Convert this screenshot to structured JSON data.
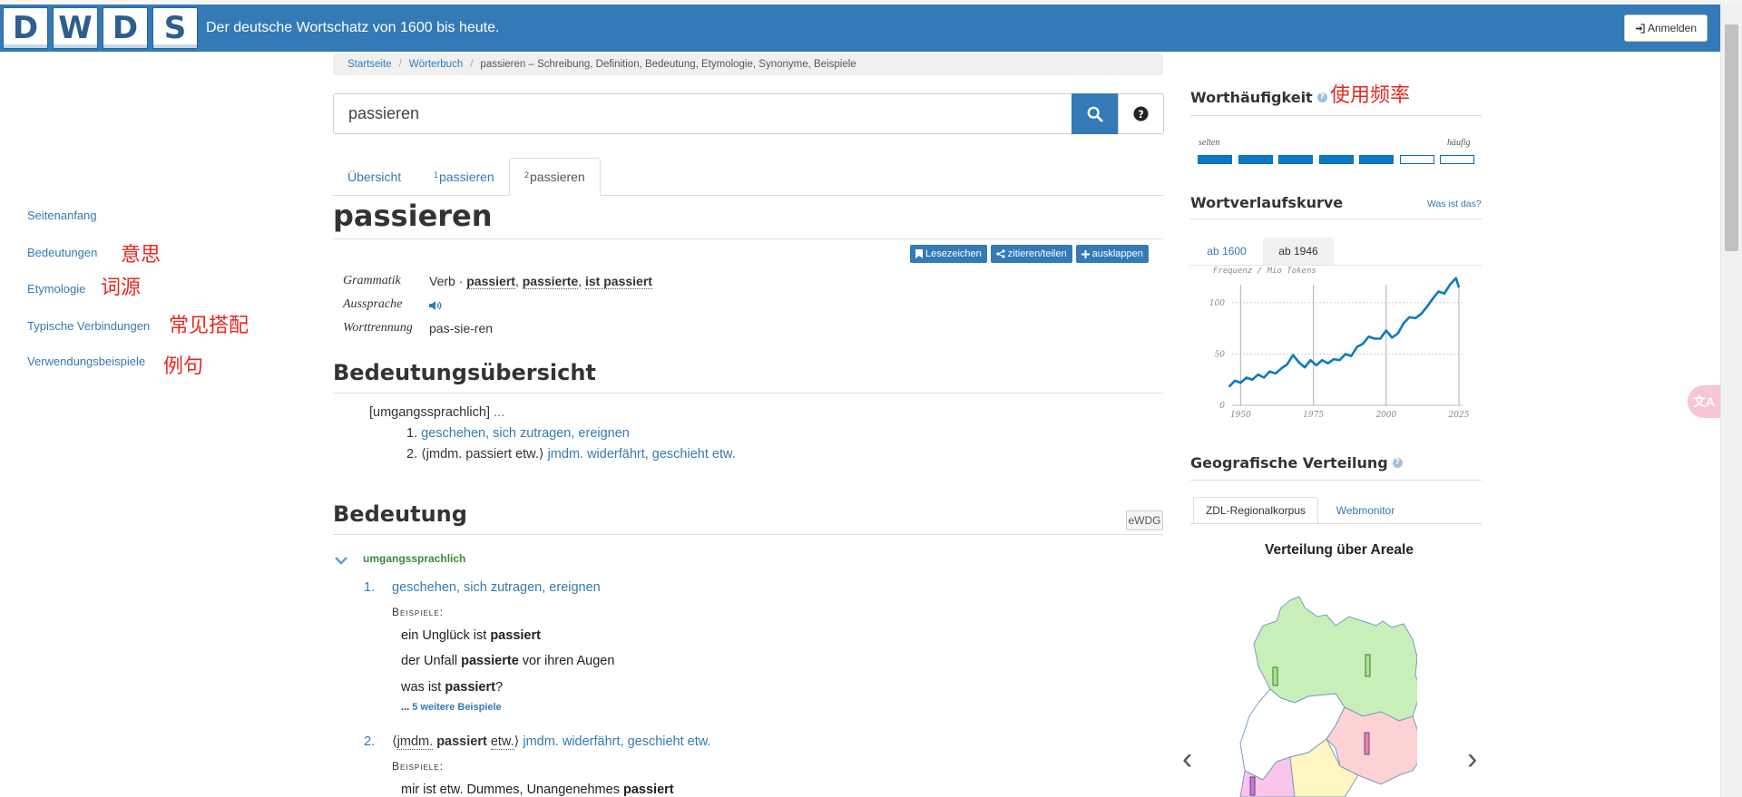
{
  "header": {
    "logo_letters": [
      "D",
      "W",
      "D",
      "S"
    ],
    "tagline": "Der deutsche Wortschatz von 1600 bis heute.",
    "login_label": "Anmelden"
  },
  "leftnav": {
    "items": [
      {
        "label": "Seitenanfang",
        "annotation": ""
      },
      {
        "label": "Bedeutungen",
        "annotation": "意思"
      },
      {
        "label": "Etymologie",
        "annotation": "词源"
      },
      {
        "label": "Typische Verbindungen",
        "annotation": "常见搭配"
      },
      {
        "label": "Verwendungsbeispiele",
        "annotation": "例句"
      }
    ]
  },
  "breadcrumb": {
    "home": "Startseite",
    "dict": "Wörterbuch",
    "current": "passieren – Schreibung, Definition, Bedeutung, Etymologie, Synonyme, Beispiele"
  },
  "search": {
    "value": "passieren"
  },
  "tabs": [
    {
      "sup": "",
      "label": "Übersicht"
    },
    {
      "sup": "1",
      "label": "passieren"
    },
    {
      "sup": "2",
      "label": "passieren"
    }
  ],
  "entry": {
    "headword": "passieren",
    "buttons": [
      "Lesezeichen",
      "zitieren/teilen",
      "ausklappen"
    ],
    "grammar_label": "Grammatik",
    "grammar_pos": "Verb ·",
    "forms": [
      "passiert",
      "passierte",
      "ist passiert"
    ],
    "pronunciation_label": "Aussprache",
    "hyphenation_label": "Worttrennung",
    "hyphenation": "pas-sie-ren"
  },
  "overview": {
    "title": "Bedeutungsübersicht",
    "register": "[umgangssprachlich]",
    "ellipsis": "...",
    "items": [
      {
        "num": "1.",
        "prefix": "",
        "text": "geschehen, sich zutragen, ereignen"
      },
      {
        "num": "2.",
        "prefix": "⟨jmdm. passiert etw.⟩",
        "text": "jmdm. widerfährt, geschieht etw."
      }
    ]
  },
  "meaning": {
    "title": "Bedeutung",
    "source": "eWDG",
    "register": "umgangssprachlich",
    "sense1_num": "1.",
    "sense1_text": "geschehen, sich zutragen, ereignen",
    "examples_label": "Beispiele:",
    "examples": [
      {
        "pre": "ein Unglück ist ",
        "bold": "passiert",
        "post": ""
      },
      {
        "pre": "der Unfall ",
        "bold": "passierte",
        "post": " vor ihren Augen"
      },
      {
        "pre": "was ist ",
        "bold": "passiert",
        "post": "?"
      }
    ],
    "more_prefix": "...",
    "more_label": "5 weitere Beispiele",
    "sense2_num": "2.",
    "sense2_construction": {
      "open": "⟨",
      "a": "jmdm.",
      "b": "passiert",
      "c": "etw.",
      "close": "⟩"
    },
    "sense2_text": "jmdm. widerfährt, geschieht etw.",
    "examples2_label": "Beispiele:",
    "example2": {
      "pre": "mir ist etw. Dummes, Unangenehmes ",
      "bold": "passiert"
    }
  },
  "frequency": {
    "title": "Worthäufigkeit",
    "annotation": "使用频率",
    "low_label": "selten",
    "high_label": "häufig",
    "level": 5,
    "max": 7
  },
  "curve": {
    "title": "Wortverlaufskurve",
    "info_link": "Was ist das?",
    "tabs": [
      "ab 1600",
      "ab 1946"
    ],
    "ylabel": "Frequenz / Mio Tokens",
    "xticks": [
      "1950",
      "1975",
      "2000",
      "2025"
    ],
    "yticks": [
      "0",
      "50",
      "100"
    ]
  },
  "chart_data": {
    "type": "line",
    "title": "",
    "xlabel": "",
    "ylabel": "Frequenz / Mio Tokens",
    "xlim": [
      1946,
      2025
    ],
    "ylim": [
      0,
      130
    ],
    "x": [
      1946,
      1948,
      1950,
      1952,
      1954,
      1956,
      1958,
      1960,
      1962,
      1964,
      1966,
      1968,
      1970,
      1972,
      1974,
      1976,
      1978,
      1980,
      1982,
      1984,
      1986,
      1988,
      1990,
      1992,
      1994,
      1996,
      1998,
      2000,
      2002,
      2004,
      2006,
      2008,
      2010,
      2012,
      2014,
      2016,
      2018,
      2020,
      2022,
      2024,
      2025
    ],
    "values": [
      18,
      24,
      22,
      27,
      25,
      30,
      27,
      33,
      31,
      36,
      40,
      49,
      42,
      37,
      44,
      39,
      44,
      41,
      45,
      44,
      50,
      48,
      57,
      60,
      67,
      65,
      65,
      73,
      66,
      70,
      80,
      86,
      85,
      89,
      96,
      104,
      111,
      109,
      118,
      124,
      115
    ]
  },
  "geo": {
    "title": "Geografische Verteilung",
    "tabs": [
      "ZDL-Regionalkorpus",
      "Webmonitor"
    ],
    "map_title": "Verteilung über Areale"
  },
  "colors": {
    "brand": "#337ab7",
    "freq": "#0a7ac2",
    "annotation": "#e8281e"
  }
}
